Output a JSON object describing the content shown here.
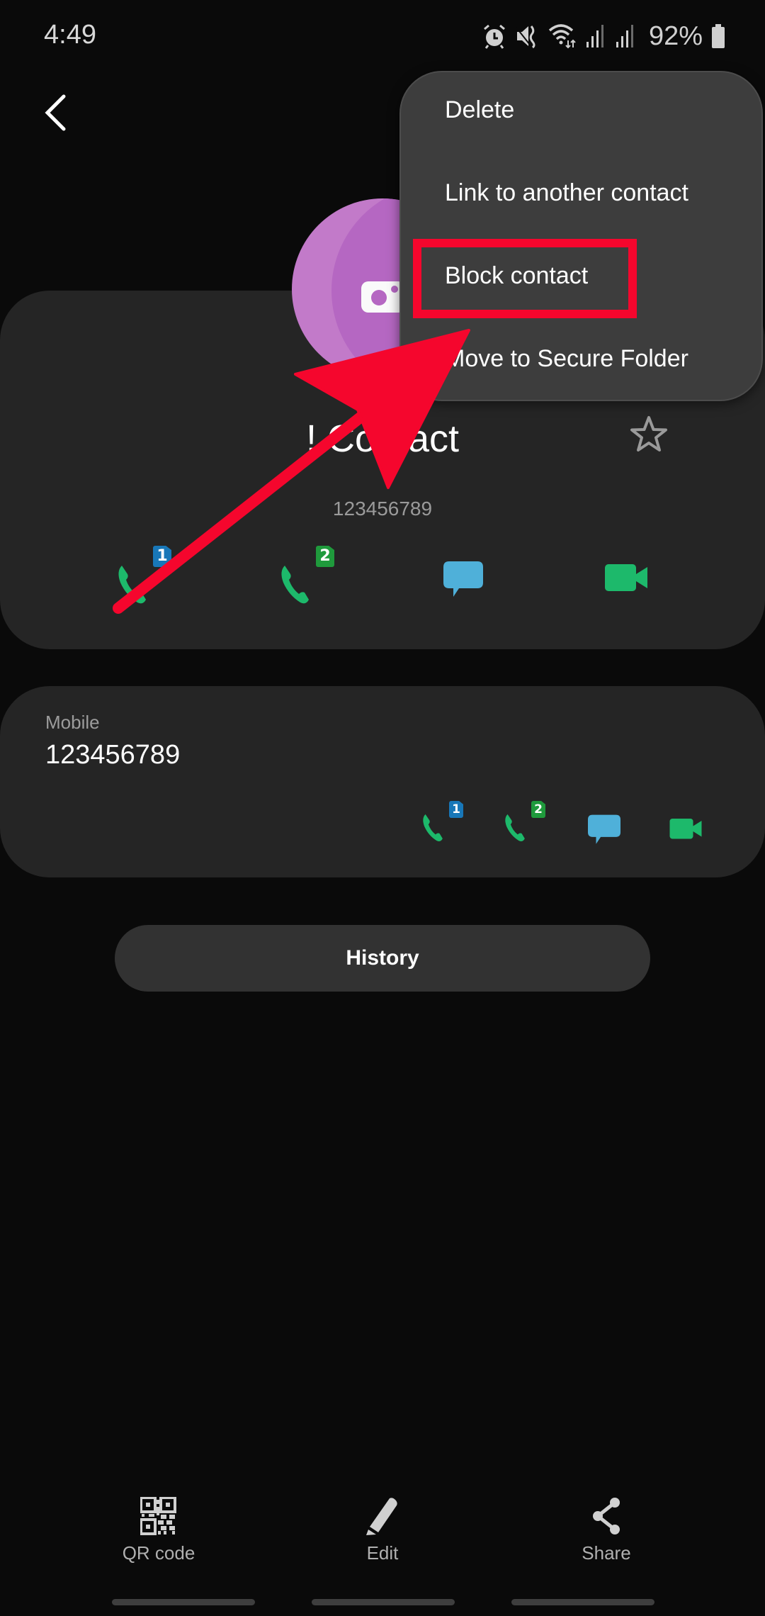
{
  "status_bar": {
    "time": "4:49",
    "icons": [
      "alarm-icon",
      "mute-icon",
      "wifi-icon",
      "signal-sim1-icon",
      "signal-sim2-icon",
      "battery-icon"
    ],
    "battery_percent": "92%"
  },
  "header": {
    "back_icon": "chevron-left-icon"
  },
  "contact": {
    "name": "! Contact",
    "subtitle": "123456789",
    "avatar_color": "#c27ac9",
    "favorite_icon": "star-outline-icon",
    "actions": [
      {
        "name": "call-sim1",
        "icon": "phone-icon",
        "badge": "1"
      },
      {
        "name": "call-sim2",
        "icon": "phone-icon",
        "badge": "2"
      },
      {
        "name": "message",
        "icon": "message-icon"
      },
      {
        "name": "video-call",
        "icon": "video-icon"
      }
    ]
  },
  "number_card": {
    "label": "Mobile",
    "value": "123456789",
    "actions": [
      {
        "name": "call-sim1",
        "icon": "phone-icon",
        "badge": "1"
      },
      {
        "name": "call-sim2",
        "icon": "phone-icon",
        "badge": "2"
      },
      {
        "name": "message",
        "icon": "message-icon"
      },
      {
        "name": "video-call",
        "icon": "video-icon"
      }
    ]
  },
  "history_button": {
    "label": "History"
  },
  "bottom_bar": {
    "items": [
      {
        "label": "QR code",
        "icon": "qr-code-icon"
      },
      {
        "label": "Edit",
        "icon": "pencil-icon"
      },
      {
        "label": "Share",
        "icon": "share-icon"
      }
    ]
  },
  "popup_menu": {
    "items": [
      {
        "label": "Delete"
      },
      {
        "label": "Link to another contact"
      },
      {
        "label": "Block contact",
        "highlighted": true
      },
      {
        "label": "Move to Secure Folder"
      }
    ]
  },
  "colors": {
    "background": "#0a0a0a",
    "card": "#252525",
    "menu": "#3d3d3d",
    "call_green": "#1db96b",
    "message_blue": "#4fb0d9",
    "sim1_blue": "#1877b8",
    "sim2_green": "#1f9a3c",
    "annotation_red": "#f5062d"
  }
}
